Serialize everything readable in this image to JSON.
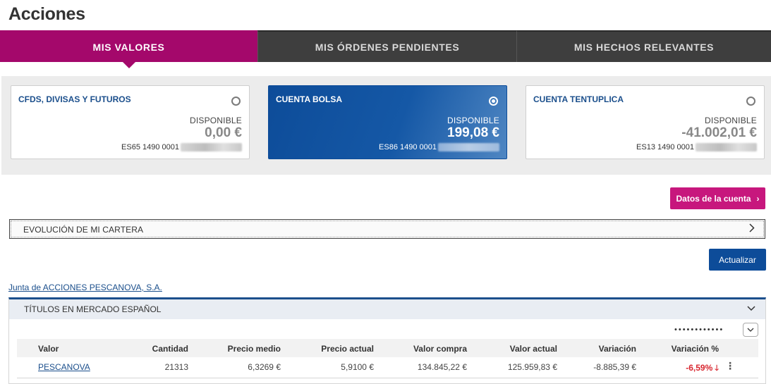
{
  "page": {
    "title": "Acciones"
  },
  "tabs": [
    {
      "label": "MIS VALORES",
      "active": true
    },
    {
      "label": "MIS ÓRDENES PENDIENTES",
      "active": false
    },
    {
      "label": "MIS HECHOS RELEVANTES",
      "active": false
    }
  ],
  "accounts": [
    {
      "name": "CFDS, DIVISAS Y FUTUROS",
      "available_label": "DISPONIBLE",
      "amount": "0,00 €",
      "iban": "ES65 1490 0001",
      "selected": false
    },
    {
      "name": "CUENTA BOLSA",
      "available_label": "DISPONIBLE",
      "amount": "199,08 €",
      "iban": "ES86 1490 0001",
      "selected": true
    },
    {
      "name": "CUENTA TENTUPLICA",
      "available_label": "DISPONIBLE",
      "amount": "-41.002,01 €",
      "iban": "ES13 1490 0001",
      "selected": false
    }
  ],
  "actions": {
    "account_data_label": "Datos de la cuenta",
    "account_data_icon": "chevron-right-icon",
    "update_label": "Actualizar"
  },
  "evolution": {
    "label": "EVOLUCIÓN DE MI CARTERA",
    "icon": "chevron-right-icon"
  },
  "junta_link": "Junta de ACCIONES PESCANOVA, S.A.",
  "market_section": {
    "title": "TÍTULOS EN MERCADO ESPAÑOL",
    "icon": "chevron-down-icon",
    "columns": [
      "Valor",
      "Cantidad",
      "Precio medio",
      "Precio actual",
      "Valor compra",
      "Valor actual",
      "Variación",
      "Variación %"
    ],
    "rows": [
      {
        "valor": "PESCANOVA",
        "cantidad": "21313",
        "precio_medio": "6,3269 €",
        "precio_actual": "5,9100 €",
        "valor_compra": "134.845,22 €",
        "valor_actual": "125.959,83 €",
        "variacion": "-8.885,39 €",
        "variacion_pct": "-6,59%",
        "trend_icon": "arrow-down-icon"
      }
    ]
  },
  "colors": {
    "brand_magenta": "#a4086b",
    "brand_blue": "#0d4c99",
    "negative": "#d8262f"
  }
}
